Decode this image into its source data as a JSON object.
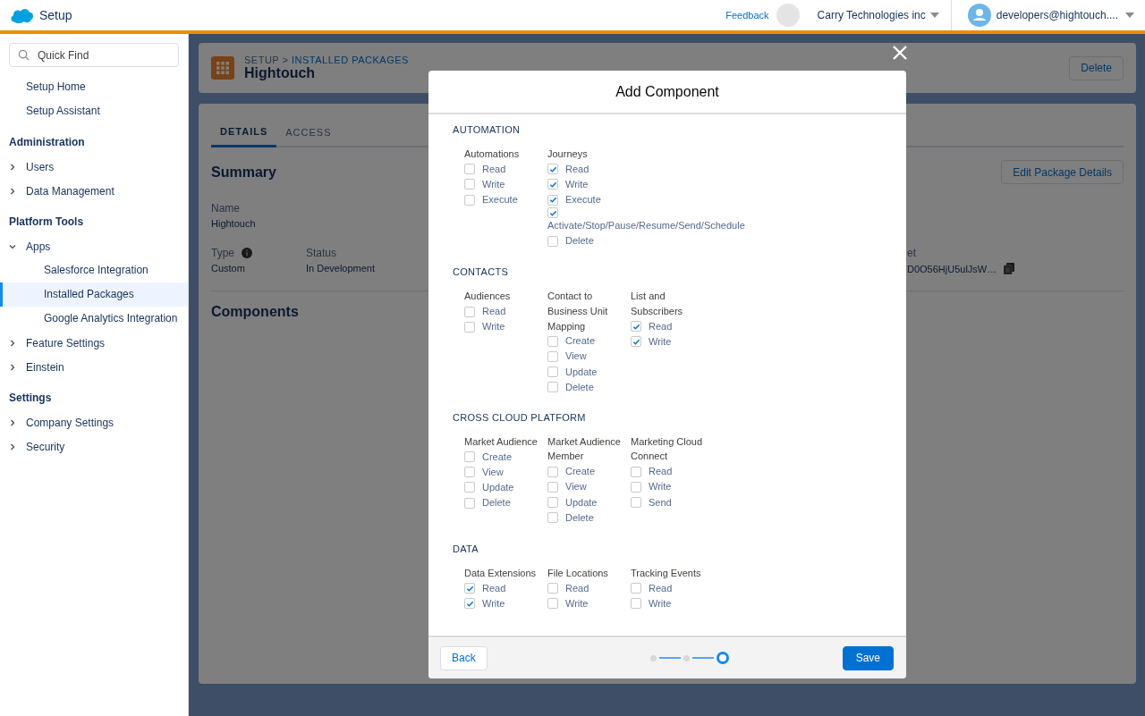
{
  "header": {
    "app_title": "Setup",
    "feedback": "Feedback",
    "org": "Carry Technologies inc",
    "user": "developers@hightouch...."
  },
  "sidebar": {
    "search": {
      "placeholder": "Quick Find"
    },
    "top_items": [
      {
        "label": "Setup Home",
        "selected": false
      },
      {
        "label": "Setup Assistant",
        "selected": false
      }
    ],
    "sections": [
      {
        "heading": "Administration",
        "items": [
          {
            "label": "Users",
            "expanded": false,
            "selected": false
          },
          {
            "label": "Data Management",
            "expanded": false,
            "selected": false
          }
        ]
      },
      {
        "heading": "Platform Tools",
        "items": [
          {
            "label": "Apps",
            "expanded": true,
            "selected": false,
            "children": [
              {
                "label": "Salesforce Integration",
                "selected": false
              },
              {
                "label": "Installed Packages",
                "selected": true
              },
              {
                "label": "Google Analytics Integration",
                "selected": false
              }
            ]
          },
          {
            "label": "Feature Settings",
            "expanded": false,
            "selected": false
          },
          {
            "label": "Einstein",
            "expanded": false,
            "selected": false
          }
        ]
      },
      {
        "heading": "Settings",
        "items": [
          {
            "label": "Company Settings",
            "expanded": false,
            "selected": false
          },
          {
            "label": "Security",
            "expanded": false,
            "selected": false
          }
        ]
      }
    ]
  },
  "page": {
    "breadcrumb": "SETUP >",
    "breadcrumb_link": "INSTALLED PACKAGES",
    "title": "Hightouch",
    "delete_button": "Delete",
    "tabs": [
      {
        "label": "DETAILS",
        "selected": true
      },
      {
        "label": "ACCESS",
        "selected": false
      }
    ],
    "summary_title": "Summary",
    "edit_button": "Edit Package Details",
    "name_label": "Name",
    "name_value": "Hightouch",
    "fields": [
      {
        "label": "Type",
        "value": "Custom",
        "info": true
      },
      {
        "label": "Status",
        "value": "In Development",
        "info": false
      }
    ],
    "cut_field": {
      "label": "et",
      "value": "D0O56HjU5ulJsW…"
    },
    "components_title": "Components"
  },
  "modal": {
    "title": "Add Component",
    "back": "Back",
    "save": "Save",
    "steps": [
      {
        "selected": false
      },
      {
        "selected": false
      },
      {
        "selected": true
      }
    ],
    "sections": [
      {
        "title": "AUTOMATION",
        "groups": [
          {
            "title": "Automations",
            "options": [
              {
                "label": "Read",
                "checked": false
              },
              {
                "label": "Write",
                "checked": false
              },
              {
                "label": "Execute",
                "checked": false
              }
            ]
          },
          {
            "title": "Journeys",
            "options": [
              {
                "label": "Read",
                "checked": true
              },
              {
                "label": "Write",
                "checked": true
              },
              {
                "label": "Execute",
                "checked": true
              },
              {
                "label": "Activate/Stop/Pause/Resume/Send/Schedule",
                "checked": true
              },
              {
                "label": "Delete",
                "checked": false
              }
            ]
          }
        ]
      },
      {
        "title": "CONTACTS",
        "groups": [
          {
            "title": "Audiences",
            "options": [
              {
                "label": "Read",
                "checked": false
              },
              {
                "label": "Write",
                "checked": false
              }
            ]
          },
          {
            "title": "Contact to Business Unit Mapping",
            "options": [
              {
                "label": "Create",
                "checked": false
              },
              {
                "label": "View",
                "checked": false
              },
              {
                "label": "Update",
                "checked": false
              },
              {
                "label": "Delete",
                "checked": false
              }
            ]
          },
          {
            "title": "List and Subscribers",
            "options": [
              {
                "label": "Read",
                "checked": true
              },
              {
                "label": "Write",
                "checked": true
              }
            ]
          }
        ]
      },
      {
        "title": "CROSS CLOUD PLATFORM",
        "groups": [
          {
            "title": "Market Audience",
            "options": [
              {
                "label": "Create",
                "checked": false
              },
              {
                "label": "View",
                "checked": false
              },
              {
                "label": "Update",
                "checked": false
              },
              {
                "label": "Delete",
                "checked": false
              }
            ]
          },
          {
            "title": "Market Audience Member",
            "options": [
              {
                "label": "Create",
                "checked": false
              },
              {
                "label": "View",
                "checked": false
              },
              {
                "label": "Update",
                "checked": false
              },
              {
                "label": "Delete",
                "checked": false
              }
            ]
          },
          {
            "title": "Marketing Cloud Connect",
            "options": [
              {
                "label": "Read",
                "checked": false
              },
              {
                "label": "Write",
                "checked": false
              },
              {
                "label": "Send",
                "checked": false
              }
            ]
          }
        ]
      },
      {
        "title": "DATA",
        "groups": [
          {
            "title": "Data Extensions",
            "options": [
              {
                "label": "Read",
                "checked": true
              },
              {
                "label": "Write",
                "checked": true
              }
            ]
          },
          {
            "title": "File Locations",
            "options": [
              {
                "label": "Read",
                "checked": false
              },
              {
                "label": "Write",
                "checked": false
              }
            ]
          },
          {
            "title": "Tracking Events",
            "options": [
              {
                "label": "Read",
                "checked": false
              },
              {
                "label": "Write",
                "checked": false
              }
            ]
          }
        ]
      }
    ]
  }
}
